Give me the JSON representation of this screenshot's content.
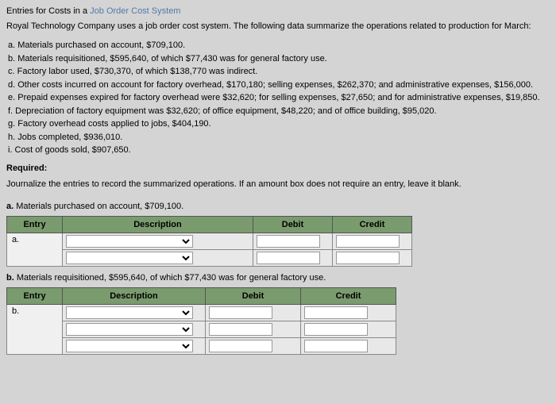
{
  "title": {
    "prefix": "Entries for Costs in a ",
    "highlight": "Job Order Cost System"
  },
  "intro": "Royal Technology Company uses a job order cost system. The following data summarize the operations related to production for March:",
  "items": {
    "a": "a. Materials purchased on account, $709,100.",
    "b": "b. Materials requisitioned, $595,640, of which $77,430 was for general factory use.",
    "c": "c. Factory labor used, $730,370, of which $138,770 was indirect.",
    "d": "d. Other costs incurred on account for factory overhead, $170,180; selling expenses, $262,370; and administrative expenses, $156,000.",
    "e": "e. Prepaid expenses expired for factory overhead were $32,620; for selling expenses, $27,650; and for administrative expenses, $19,850.",
    "f": "f. Depreciation of factory equipment was $32,620; of office equipment, $48,220; and of office building, $95,020.",
    "g": "g. Factory overhead costs applied to jobs, $404,190.",
    "h": "h. Jobs completed, $936,010.",
    "i": "i. Cost of goods sold, $907,650."
  },
  "required_label": "Required:",
  "instructions": "Journalize the entries to record the summarized operations. If an amount box does not require an entry, leave it blank.",
  "section_a": {
    "letter": "a.",
    "text": " Materials purchased on account, $709,100."
  },
  "section_b": {
    "letter": "b.",
    "text": " Materials requisitioned, $595,640, of which $77,430 was for general factory use."
  },
  "headers": {
    "entry": "Entry",
    "description": "Description",
    "debit": "Debit",
    "credit": "Credit"
  },
  "row_labels": {
    "a": "a.",
    "b": "b."
  }
}
